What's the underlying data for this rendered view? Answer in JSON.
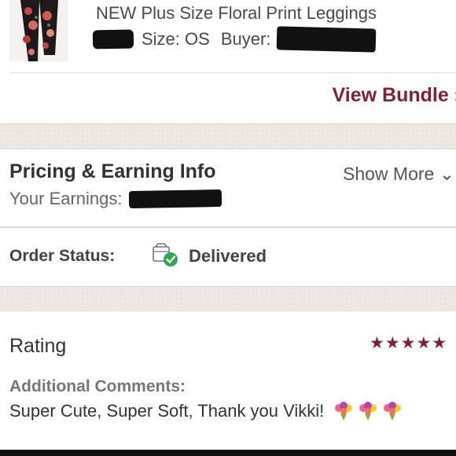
{
  "item": {
    "title": "NEW Plus Size Floral Print Leggings",
    "size_label": "Size: OS",
    "buyer_label": "Buyer:",
    "thumbnail_icon": "floral-leggings-thumbnail"
  },
  "bundle": {
    "link_label": "View Bundle ›"
  },
  "pricing": {
    "title": "Pricing & Earning Info",
    "show_more": "Show More ⌄",
    "earnings_label": "Your Earnings:"
  },
  "order_status": {
    "label": "Order Status:",
    "value": "Delivered",
    "icon": "delivered-package-icon"
  },
  "rating": {
    "title": "Rating",
    "stars": 5,
    "stars_text": "★★★★★",
    "comments_label": "Additional Comments:",
    "comment": "Super Cute, Super Soft, Thank you Vikki!",
    "emoji": [
      "bouquet-icon",
      "bouquet-icon",
      "bouquet-icon"
    ]
  },
  "colors": {
    "accent": "#7d2331",
    "check": "#2fa84f",
    "band": "#ede8e3"
  }
}
